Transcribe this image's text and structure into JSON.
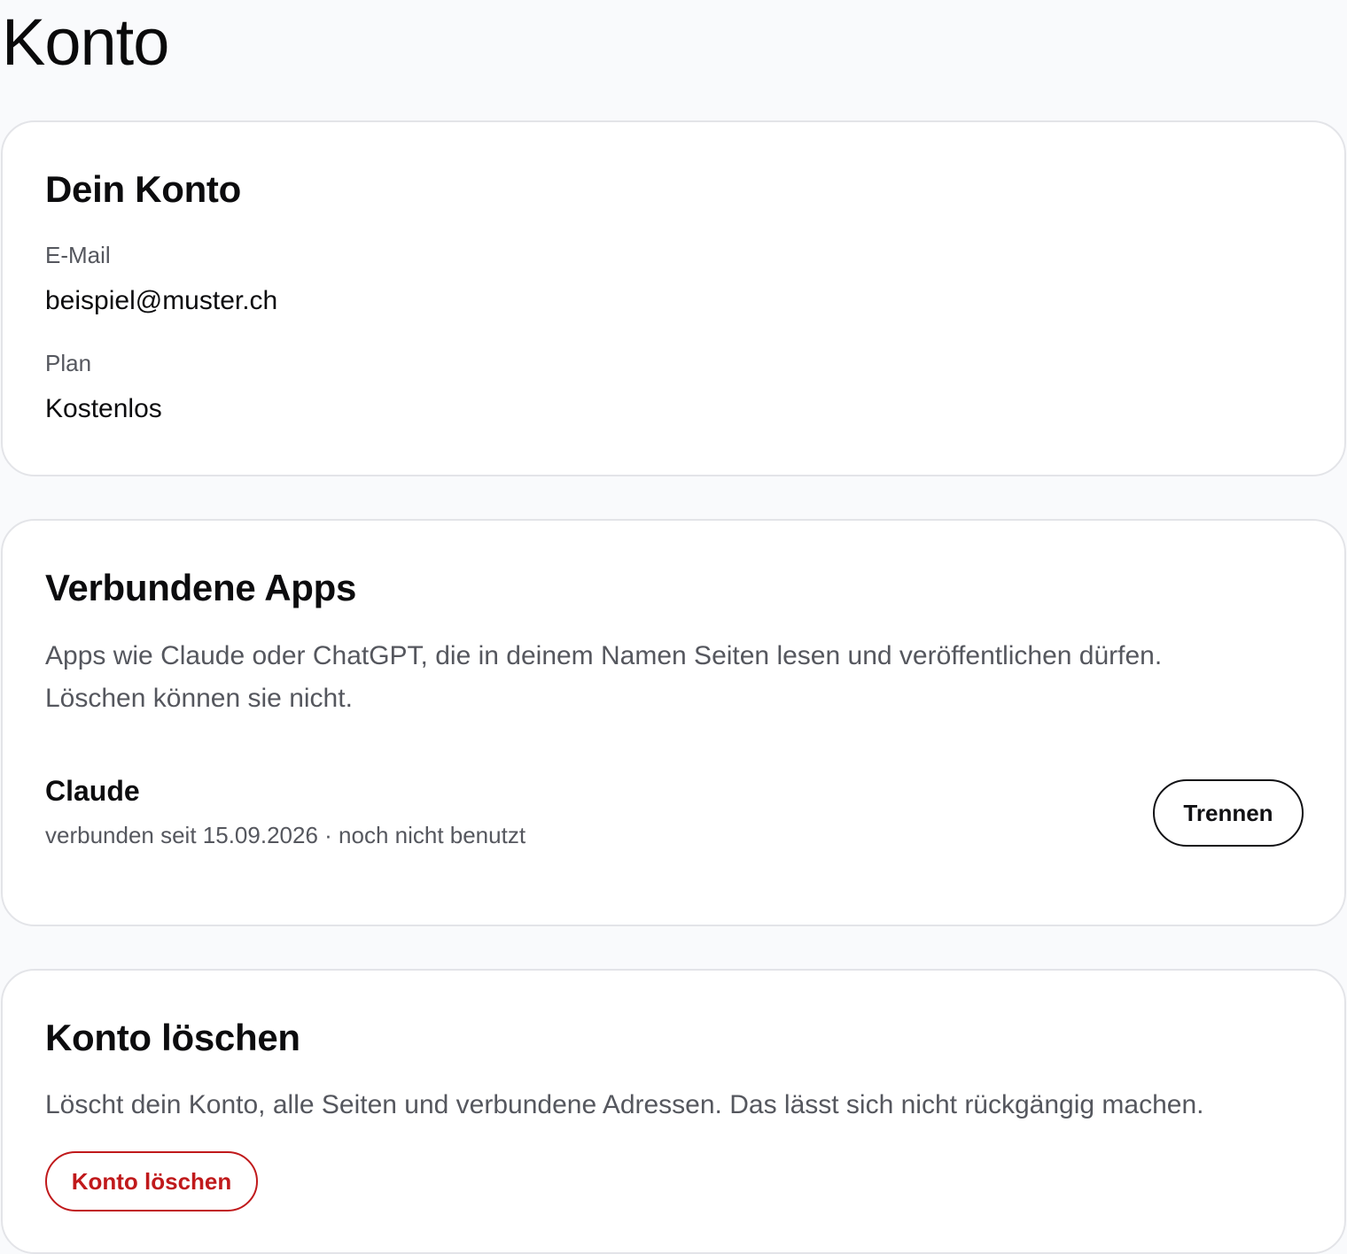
{
  "page": {
    "title": "Konto"
  },
  "account": {
    "title": "Dein Konto",
    "email_label": "E-Mail",
    "email_value": "beispiel@muster.ch",
    "plan_label": "Plan",
    "plan_value": "Kostenlos"
  },
  "connected_apps": {
    "title": "Verbundene Apps",
    "description_line1": "Apps wie Claude oder ChatGPT, die in deinem Namen Seiten lesen und veröffentlichen dürfen.",
    "description_line2": "Löschen können sie nicht.",
    "apps": [
      {
        "name": "Claude",
        "meta": "verbunden seit 15.09.2026 · noch nicht benutzt",
        "action_label": "Trennen"
      }
    ]
  },
  "delete_account": {
    "title": "Konto löschen",
    "description": "Löscht dein Konto, alle Seiten und verbundene Adressen. Das lässt sich nicht rückgängig machen.",
    "button_label": "Konto löschen",
    "danger_color": "#c0191b"
  }
}
